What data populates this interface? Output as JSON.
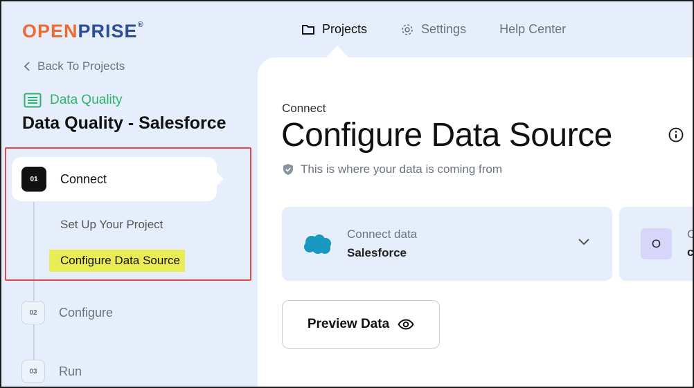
{
  "logo": {
    "part1": "OPEN",
    "part2": "PRISE",
    "reg": "®"
  },
  "topnav": {
    "items": [
      {
        "label": "Projects",
        "icon": "folder-icon",
        "active": true
      },
      {
        "label": "Settings",
        "icon": "gear-icon",
        "active": false
      },
      {
        "label": "Help Center",
        "icon": "",
        "active": false
      }
    ]
  },
  "sidebar": {
    "back_label": "Back To Projects",
    "category_label": "Data Quality",
    "project_title": "Data Quality - Salesforce",
    "steps": [
      {
        "number": "01",
        "label": "Connect"
      },
      {
        "number": "02",
        "label": "Configure"
      },
      {
        "number": "03",
        "label": "Run"
      }
    ],
    "sub_items": [
      {
        "label": "Set Up Your Project"
      },
      {
        "label": "Configure Data Source"
      }
    ]
  },
  "main": {
    "eyebrow": "Connect",
    "title": "Configure Data Source",
    "subtitle": "This is where your data is coming from",
    "card": {
      "label": "Connect data",
      "value": "Salesforce"
    },
    "card2": {
      "avatar_letter": "O",
      "peek_label": "C",
      "peek_value": "c"
    },
    "preview_button": "Preview Data"
  },
  "colors": {
    "accent_orange": "#ee6a33",
    "brand_blue": "#2a4e9a",
    "green": "#2bb36b",
    "highlight": "#e9ec55",
    "annotation_red": "#e04a4a",
    "salesforce_blue": "#1798c1"
  }
}
